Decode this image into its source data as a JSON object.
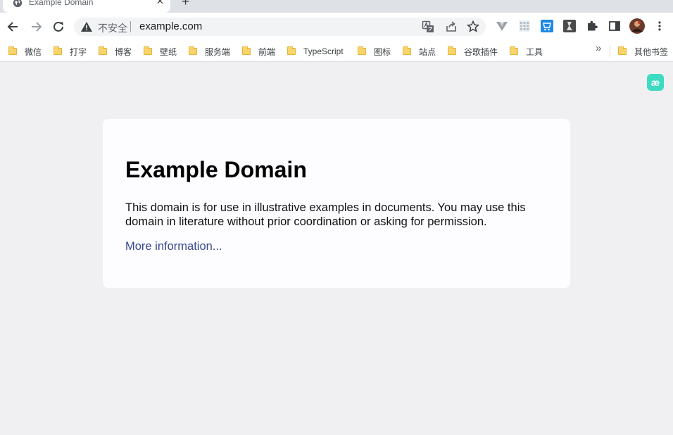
{
  "tab": {
    "title": "Example Domain",
    "close_glyph": "✕",
    "new_tab_glyph": "+"
  },
  "omnibox": {
    "security_label": "不安全",
    "url": "example.com"
  },
  "bookmarks": {
    "items": [
      {
        "label": "微信"
      },
      {
        "label": "打字"
      },
      {
        "label": "博客"
      },
      {
        "label": "壁纸"
      },
      {
        "label": "服务端"
      },
      {
        "label": "前端"
      },
      {
        "label": "TypeScript"
      },
      {
        "label": "图标"
      },
      {
        "label": "站点"
      },
      {
        "label": "谷歌插件"
      },
      {
        "label": "工具"
      }
    ],
    "more_glyph": "»",
    "other_label": "其他书签"
  },
  "extension": {
    "ae_label": "æ"
  },
  "page": {
    "title": "Example Domain",
    "description": "This domain is for use in illustrative examples in documents. You may use this domain in literature without prior coordination or asking for permission.",
    "link_text": "More information..."
  },
  "colors": {
    "page_background": "#f0f0f2",
    "card_background": "#fdfdff",
    "link": "#38488f",
    "extension_accent": "#3ddbc1"
  }
}
